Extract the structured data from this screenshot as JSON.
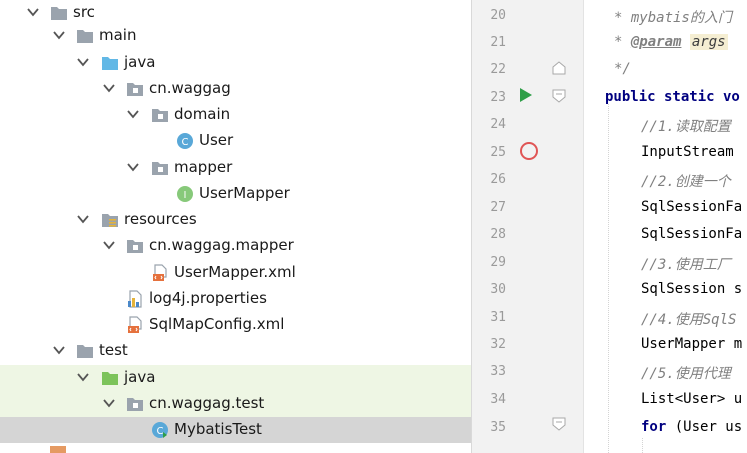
{
  "tree": {
    "items": [
      {
        "label": "src"
      },
      {
        "label": "main"
      },
      {
        "label": "java"
      },
      {
        "label": "cn.waggag"
      },
      {
        "label": "domain"
      },
      {
        "label": "User"
      },
      {
        "label": "mapper"
      },
      {
        "label": "UserMapper"
      },
      {
        "label": "resources"
      },
      {
        "label": "cn.waggag.mapper"
      },
      {
        "label": "UserMapper.xml"
      },
      {
        "label": "log4j.properties"
      },
      {
        "label": "SqlMapConfig.xml"
      },
      {
        "label": "test"
      },
      {
        "label": "java"
      },
      {
        "label": "cn.waggag.test"
      },
      {
        "label": "MybatisTest"
      }
    ],
    "badge_class": "C",
    "badge_interface": "I"
  },
  "editor": {
    "line_numbers": [
      "20",
      "21",
      "22",
      "23",
      "24",
      "25",
      "26",
      "27",
      "28",
      "29",
      "30",
      "31",
      "32",
      "33",
      "34",
      "35"
    ],
    "lines": {
      "l20": "* mybatis的入门",
      "l21_star": "* ",
      "l21_tag": "@param",
      "l21_arg": "args",
      "l22": "*/",
      "l23": "public static vo",
      "l24": "//1.读取配置",
      "l25": "InputStream ",
      "l26": "//2.创建一个",
      "l27": "SqlSessionFa",
      "l28": "SqlSessionFa",
      "l29": "//3.使用工厂",
      "l30": "SqlSession s",
      "l31": "//4.使用SqlS",
      "l32": "UserMapper m",
      "l33": "//5.使用代理",
      "l34": "List<User> u",
      "l35_kw": "for",
      "l35_rest": " (User us"
    }
  },
  "colors": {
    "folder": "#9aa3ad",
    "java_source_folder": "#62b8e6",
    "test_folder": "#7cc35a",
    "class_badge": "#59a8d8",
    "interface_badge": "#87c97a",
    "breakpoint": "#e05555",
    "run_arrow": "#2e9e48",
    "selected_row": "#d5d5d5"
  }
}
